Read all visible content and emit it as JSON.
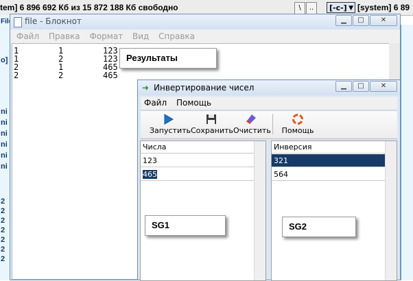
{
  "background": {
    "status_text": "tem]  6 896 692 Кб из 15 872 188 Кб свободно",
    "button_backslash": "\\",
    "button_dots": "..",
    "drive_select": "[-c-]",
    "system_label": "[system]  6 89",
    "left_edge_chars": [
      "File",
      "o]",
      "ni",
      "ni",
      "ni",
      "ni",
      "ni",
      "ni",
      "2",
      "2",
      "2",
      "2",
      "2",
      "2",
      "2"
    ]
  },
  "notepad": {
    "title": "file - Блокнот",
    "menu": [
      "Файл",
      "Правка",
      "Формат",
      "Вид",
      "Справка"
    ],
    "lines": [
      "1        1        123",
      "1        2        123",
      "2        1        465",
      "2        2        465"
    ]
  },
  "labels": {
    "results": "Результаты",
    "sg1": "SG1",
    "sg2": "SG2"
  },
  "app": {
    "title": "Инвертирование чисел",
    "menu": [
      "Файл",
      "Помощь"
    ],
    "toolbar": {
      "run": "Запустить",
      "save": "Сохранить",
      "clear": "Очистить",
      "help": "Помощь"
    },
    "left_grid": {
      "header": "Числа",
      "rows": [
        "123",
        "465"
      ]
    },
    "right_grid": {
      "header": "Инверсия",
      "rows": [
        "321",
        "564"
      ]
    }
  },
  "colors": {
    "selection": "#173b66",
    "run_icon": "#1e73c8"
  }
}
